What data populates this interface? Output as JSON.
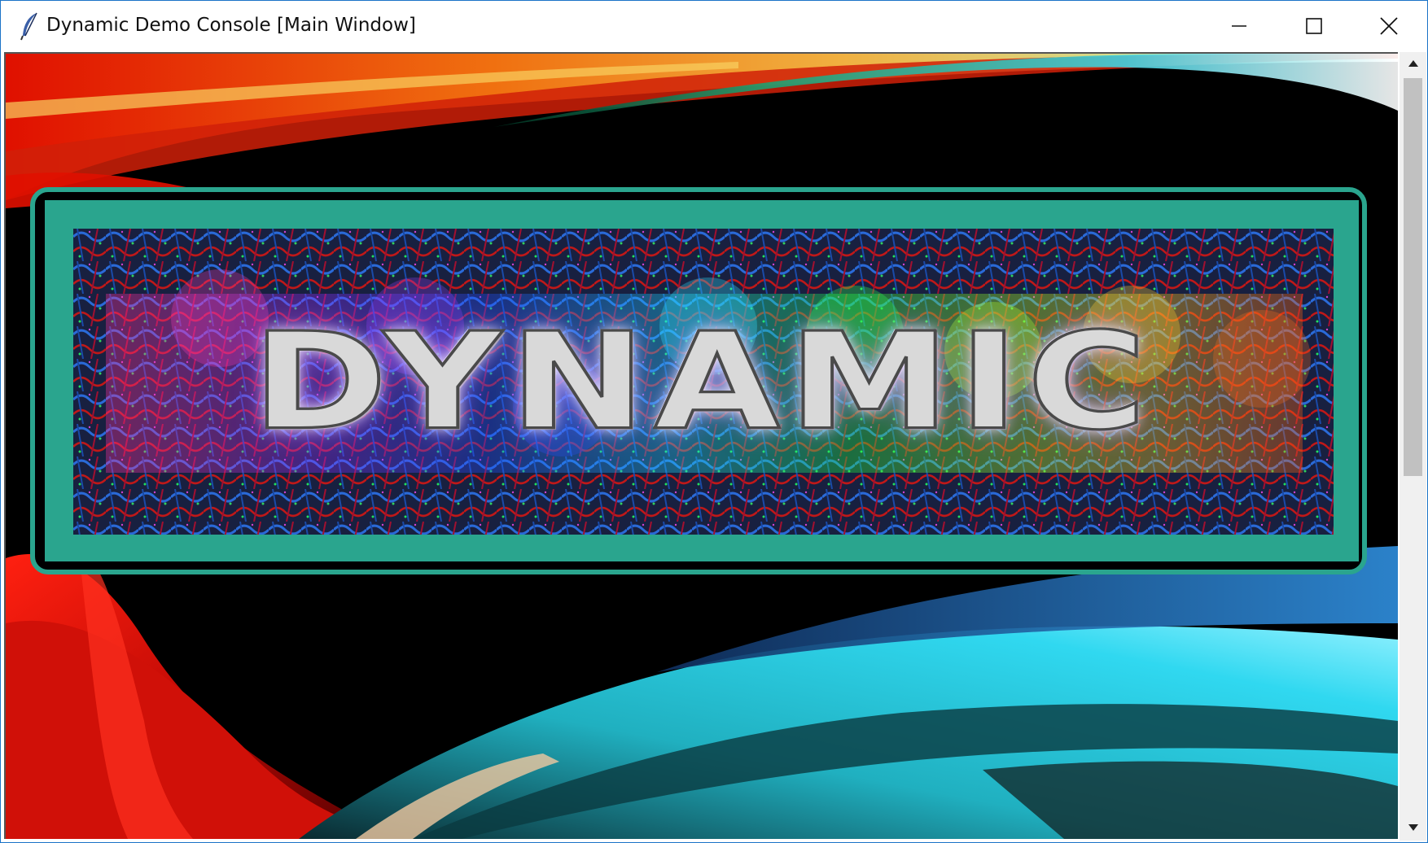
{
  "window": {
    "title": "Dynamic Demo Console [Main Window]",
    "app_icon": "feather-icon",
    "controls": {
      "minimize_icon": "minimize-icon",
      "maximize_icon": "maximize-icon",
      "close_icon": "close-icon"
    }
  },
  "banner": {
    "logo_text": "DYNAMIC",
    "frame_color": "#2aa58e"
  },
  "scrollbar": {
    "up_icon": "scroll-up-arrow-icon",
    "down_icon": "scroll-down-arrow-icon",
    "position": 0.0
  },
  "colors": {
    "background": "#000000",
    "accent_teal": "#2aa58e",
    "swirl_red": "#e0150a",
    "swirl_cyan": "#18c8e0",
    "swirl_orange": "#f0a020"
  }
}
